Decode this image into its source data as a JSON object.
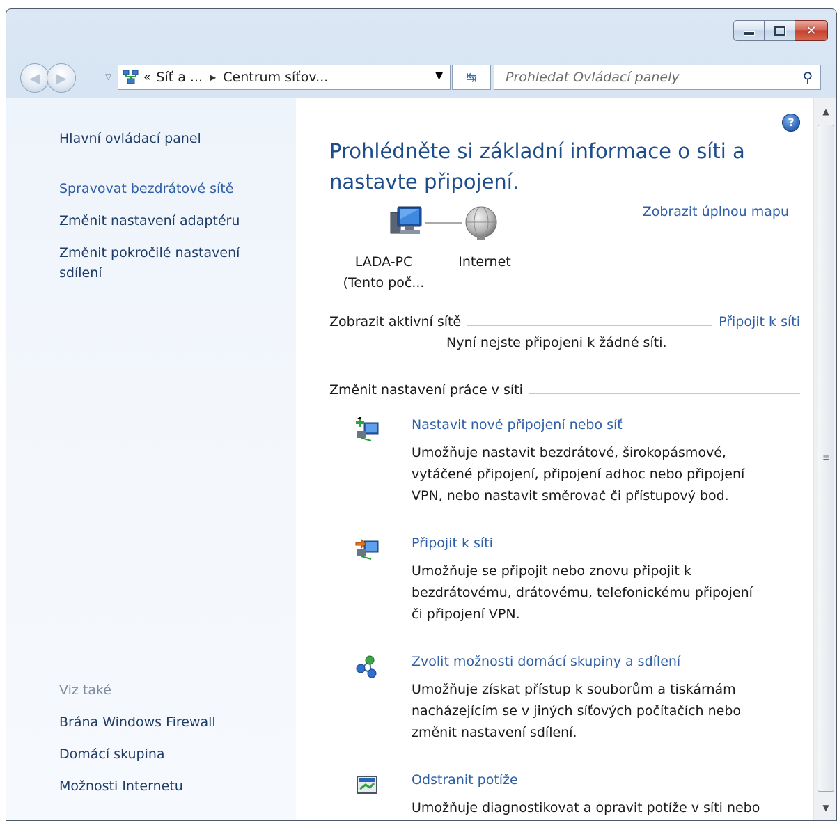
{
  "window": {
    "caption": {
      "minimize_icon": "minimize-icon",
      "maximize_icon": "maximize-icon",
      "close_icon": "close-icon"
    }
  },
  "navbar": {
    "crumbs": [
      "Síť a ...",
      "Centrum síťov..."
    ],
    "overflow": "«",
    "search_placeholder": "Prohledat Ovládací panely"
  },
  "sidebar": {
    "home": "Hlavní ovládací panel",
    "links": [
      "Spravovat bezdrátové sítě",
      "Změnit nastavení adaptéru",
      "Změnit pokročilé nastavení",
      "sdílení"
    ],
    "see_also_title": "Viz také",
    "see_also": [
      "Brána Windows Firewall",
      "Domácí skupina",
      "Možnosti Internetu"
    ]
  },
  "main": {
    "title_line1": "Prohlédněte si základní informace o síti a",
    "title_line2": "nastavte připojení.",
    "full_map_link": "Zobrazit úplnou mapu",
    "map": {
      "pc_label_line1": "LADA-PC",
      "pc_label_line2": "(Tento poč...",
      "internet_label": "Internet"
    },
    "active_networks": {
      "heading": "Zobrazit aktivní sítě",
      "connect_link": "Připojit k síti",
      "status": "Nyní nejste připojeni k žádné síti."
    },
    "change_settings_heading": "Změnit nastavení práce v síti",
    "tasks": [
      {
        "title": "Nastavit nové připojení nebo síť",
        "lines": [
          "Umožňuje nastavit bezdrátové, širokopásmové,",
          "vytáčené připojení, připojení adhoc nebo připojení",
          "VPN, nebo nastavit směrovač či přístupový bod."
        ],
        "icon": "new-connection-icon"
      },
      {
        "title": "Připojit k síti",
        "lines": [
          "Umožňuje se připojit nebo znovu připojit k",
          "bezdrátovému, drátovému, telefonickému připojení",
          "či připojení VPN."
        ],
        "icon": "connect-network-icon"
      },
      {
        "title": "Zvolit možnosti domácí skupiny a sdílení",
        "lines": [
          "Umožňuje získat přístup k souborům a tiskárnám",
          "nacházejícím se v jiných síťových počítačích nebo",
          "změnit nastavení sdílení."
        ],
        "icon": "homegroup-icon"
      },
      {
        "title": "Odstranit potíže",
        "lines": [
          "Umožňuje diagnostikovat a opravit potíže v síti nebo"
        ],
        "icon": "troubleshoot-icon"
      }
    ]
  }
}
